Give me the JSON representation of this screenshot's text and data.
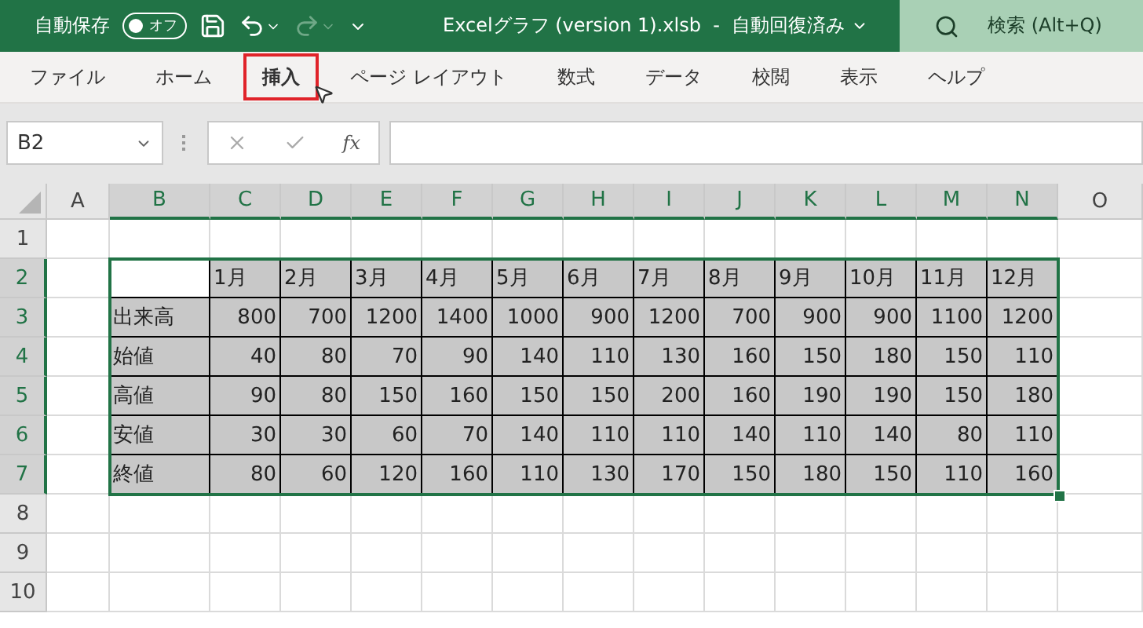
{
  "title_bar": {
    "autosave_label": "自動保存",
    "autosave_toggle": {
      "label": "オフ",
      "on": false
    },
    "file_title": "Excelグラフ (version 1).xlsb  -  自動回復済み",
    "search": {
      "placeholder": "検索 (Alt+Q)"
    }
  },
  "ribbon_tabs": [
    {
      "label": "ファイル",
      "highlighted": false
    },
    {
      "label": "ホーム",
      "highlighted": false
    },
    {
      "label": "挿入",
      "highlighted": true
    },
    {
      "label": "ページ レイアウト",
      "highlighted": false
    },
    {
      "label": "数式",
      "highlighted": false
    },
    {
      "label": "データ",
      "highlighted": false
    },
    {
      "label": "校閲",
      "highlighted": false
    },
    {
      "label": "表示",
      "highlighted": false
    },
    {
      "label": "ヘルプ",
      "highlighted": false
    }
  ],
  "formula_bar": {
    "name_box": "B2",
    "fx": "fx"
  },
  "sheet": {
    "columns": [
      {
        "label": "A",
        "selected": false
      },
      {
        "label": "B",
        "selected": true
      },
      {
        "label": "C",
        "selected": true
      },
      {
        "label": "D",
        "selected": true
      },
      {
        "label": "E",
        "selected": true
      },
      {
        "label": "F",
        "selected": true
      },
      {
        "label": "G",
        "selected": true
      },
      {
        "label": "H",
        "selected": true
      },
      {
        "label": "I",
        "selected": true
      },
      {
        "label": "J",
        "selected": true
      },
      {
        "label": "K",
        "selected": true
      },
      {
        "label": "L",
        "selected": true
      },
      {
        "label": "M",
        "selected": true
      },
      {
        "label": "N",
        "selected": true
      },
      {
        "label": "O",
        "selected": false
      }
    ],
    "rows": [
      {
        "label": "1",
        "selected": false
      },
      {
        "label": "2",
        "selected": true
      },
      {
        "label": "3",
        "selected": true
      },
      {
        "label": "4",
        "selected": true
      },
      {
        "label": "5",
        "selected": true
      },
      {
        "label": "6",
        "selected": true
      },
      {
        "label": "7",
        "selected": true
      },
      {
        "label": "8",
        "selected": false
      },
      {
        "label": "9",
        "selected": false
      },
      {
        "label": "10",
        "selected": false
      }
    ],
    "table": {
      "header": [
        "1月",
        "2月",
        "3月",
        "4月",
        "5月",
        "6月",
        "7月",
        "8月",
        "9月",
        "10月",
        "11月",
        "12月"
      ],
      "rows": [
        {
          "label": "出来高",
          "values": [
            "800",
            "700",
            "1200",
            "1400",
            "1000",
            "900",
            "1200",
            "700",
            "900",
            "900",
            "1100",
            "1200"
          ]
        },
        {
          "label": "始値",
          "values": [
            "40",
            "80",
            "70",
            "90",
            "140",
            "110",
            "130",
            "160",
            "150",
            "180",
            "150",
            "110"
          ]
        },
        {
          "label": "高値",
          "values": [
            "90",
            "80",
            "150",
            "160",
            "150",
            "150",
            "200",
            "160",
            "190",
            "190",
            "150",
            "180"
          ]
        },
        {
          "label": "安値",
          "values": [
            "30",
            "30",
            "60",
            "70",
            "140",
            "110",
            "110",
            "140",
            "110",
            "140",
            "80",
            "110"
          ]
        },
        {
          "label": "終値",
          "values": [
            "80",
            "60",
            "120",
            "160",
            "110",
            "130",
            "170",
            "150",
            "180",
            "150",
            "110",
            "160"
          ]
        }
      ]
    }
  }
}
